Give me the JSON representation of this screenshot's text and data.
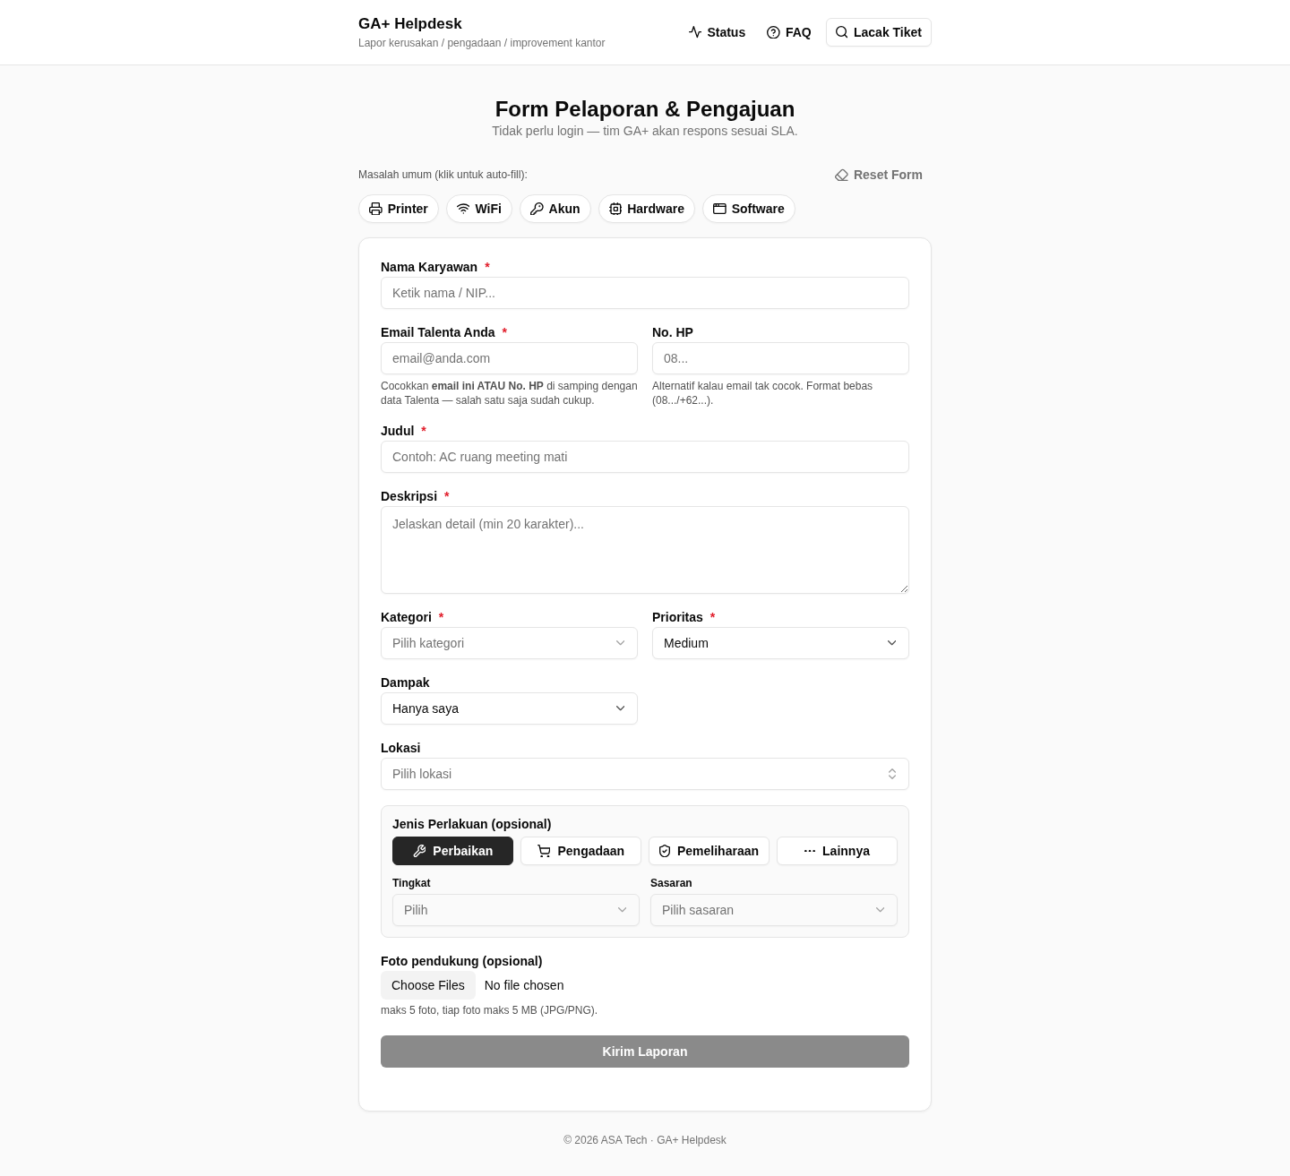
{
  "header": {
    "title": "GA+ Helpdesk",
    "subtitle": "Lapor kerusakan / pengadaan / improvement kantor",
    "nav": [
      {
        "label": "Status",
        "kind": "link"
      },
      {
        "label": "FAQ",
        "kind": "link"
      },
      {
        "label": "Lacak Tiket",
        "kind": "button"
      }
    ]
  },
  "page": {
    "title": "Form Pelaporan & Pengajuan",
    "subtitle": "Tidak perlu login — tim GA+ akan respons sesuai SLA."
  },
  "quick_fill": {
    "label": "Masalah umum (klik untuk auto-fill):",
    "reset": "Reset Form",
    "chips": [
      "Printer",
      "WiFi",
      "Akun",
      "Hardware",
      "Software"
    ]
  },
  "form": {
    "groups": [
      [
        {
          "label": "Nama Karyawan",
          "required_mark": "*",
          "kind": "text",
          "placeholder": "Ketik nama / NIP..."
        }
      ],
      [
        {
          "label": "Email Talenta Anda",
          "required_mark": "*",
          "kind": "text",
          "placeholder": "email@anda.com",
          "hint": "Cocokkan **email ini ATAU No. HP** di samping dengan data Talenta — salah satu saja sudah cukup."
        },
        {
          "label": "No. HP",
          "kind": "text",
          "placeholder": "08...",
          "hint": "Alternatif kalau email tak cocok. Format bebas (08.../+62...)."
        }
      ],
      [
        {
          "label": "Judul",
          "required_mark": "*",
          "kind": "text",
          "placeholder": "Contoh: AC ruang meeting mati"
        }
      ],
      [
        {
          "label": "Deskripsi",
          "required_mark": "*",
          "kind": "textarea",
          "placeholder": "Jelaskan detail (min 20 karakter)..."
        }
      ],
      [
        {
          "label": "Kategori",
          "required_mark": "*",
          "kind": "select",
          "placeholder": "Pilih kategori"
        },
        {
          "label": "Prioritas",
          "required_mark": "*",
          "kind": "select",
          "value": "Medium"
        },
        {
          "label": "Dampak",
          "kind": "select",
          "value": "Hanya saya"
        }
      ],
      [
        {
          "label": "Lokasi",
          "kind": "combobox",
          "placeholder": "Pilih lokasi"
        }
      ]
    ],
    "treatment": {
      "title": "Jenis Perlakuan (opsional)",
      "options": [
        {
          "label": "Perbaikan",
          "selected": true
        },
        {
          "label": "Pengadaan",
          "selected": false
        },
        {
          "label": "Pemeliharaan",
          "selected": false
        },
        {
          "label": "Lainnya",
          "selected": false
        }
      ],
      "fields": [
        {
          "label": "Tingkat",
          "kind": "select",
          "placeholder": "Pilih"
        },
        {
          "label": "Sasaran",
          "kind": "select",
          "placeholder": "Pilih sasaran"
        }
      ]
    },
    "photos": {
      "label": "Foto pendukung (opsional)",
      "button": "Choose Files",
      "status": "No file chosen",
      "hint": "maks 5 foto, tiap foto maks 5 MB (JPG/PNG)."
    },
    "submit": {
      "label": "Kirim Laporan",
      "disabled": true
    }
  },
  "footer": "© 2026 ASA Tech · GA+ Helpdesk"
}
